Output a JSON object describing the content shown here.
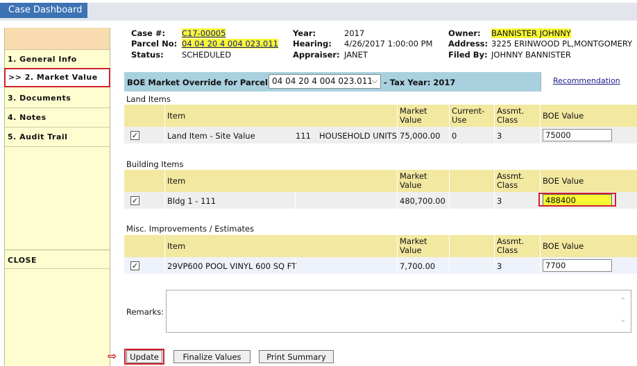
{
  "app": {
    "title": "Case Dashboard"
  },
  "sidebar": {
    "items": [
      {
        "label": "1. General Info"
      },
      {
        "label": ">> 2. Market Value"
      },
      {
        "label": "3. Documents"
      },
      {
        "label": "4. Notes"
      },
      {
        "label": "5. Audit Trail"
      }
    ],
    "close_label": "CLOSE"
  },
  "case": {
    "case_no_label": "Case #:",
    "case_no": "C17-00005",
    "parcel_label": "Parcel No:",
    "parcel_no": "04 04 20 4 004 023.011",
    "status_label": "Status:",
    "status": "SCHEDULED",
    "year_label": "Year:",
    "year": "2017",
    "hearing_label": "Hearing:",
    "hearing": "4/26/2017 1:00:00 PM",
    "appraiser_label": "Appraiser:",
    "appraiser": "JANET",
    "owner_label": "Owner:",
    "owner": "BANNISTER JOHNNY",
    "address_label": "Address:",
    "address": "3225 ERINWOOD PL,MONTGOMERY",
    "filed_by_label": "Filed By:",
    "filed_by": "JOHNNY BANNISTER"
  },
  "boe": {
    "label": "BOE Market Override for Parcel :",
    "parcel_selected": "04 04 20 4 004 023.011",
    "tax_year_label": "- Tax Year: 2017",
    "recommendation": "Recommendation"
  },
  "land": {
    "title": "Land Items",
    "headers": {
      "item": "Item",
      "market1": "Market",
      "market2": "Value",
      "current1": "Current-",
      "current2": "Use",
      "assmt1": "Assmt.",
      "assmt2": "Class",
      "boe": "BOE Value"
    },
    "rows": [
      {
        "check": "✓",
        "item": "Land Item - Site Value",
        "code": "111",
        "units": "HOUSEHOLD UNITS",
        "market": "75,000.00",
        "current": "0",
        "assmt": "3",
        "boe": "75000"
      }
    ]
  },
  "building": {
    "title": "Building Items",
    "headers": {
      "item": "Item",
      "market1": "Market",
      "market2": "Value",
      "assmt1": "Assmt.",
      "assmt2": "Class",
      "boe": "BOE Value"
    },
    "rows": [
      {
        "check": "✓",
        "item": "Bldg 1 - 111",
        "market": "480,700.00",
        "assmt": "3",
        "boe": "488400"
      }
    ]
  },
  "misc": {
    "title": "Misc. Improvements / Estimates",
    "headers": {
      "item": "Item",
      "market1": "Market",
      "market2": "Value",
      "assmt1": "Assmt.",
      "assmt2": "Class",
      "boe": "BOE Value"
    },
    "rows": [
      {
        "check": "✓",
        "item": "29VP600 POOL VINYL 600 SQ FT",
        "market": "7,700.00",
        "assmt": "3",
        "boe": "7700"
      }
    ]
  },
  "remarks": {
    "label": "Remarks:",
    "value": ""
  },
  "buttons": {
    "update": "Update",
    "finalize": "Finalize Values",
    "print": "Print Summary"
  },
  "icons": {
    "checkbox": "check-icon",
    "dropdown": "chevron-down-icon",
    "arrow": "arrow-right-icon"
  },
  "colors": {
    "title_bar": "#3d72b3",
    "header_bar": "#a9d0df",
    "table_header": "#f2e8a0",
    "highlight": "#f7f736",
    "annotation": "#d0202a"
  }
}
